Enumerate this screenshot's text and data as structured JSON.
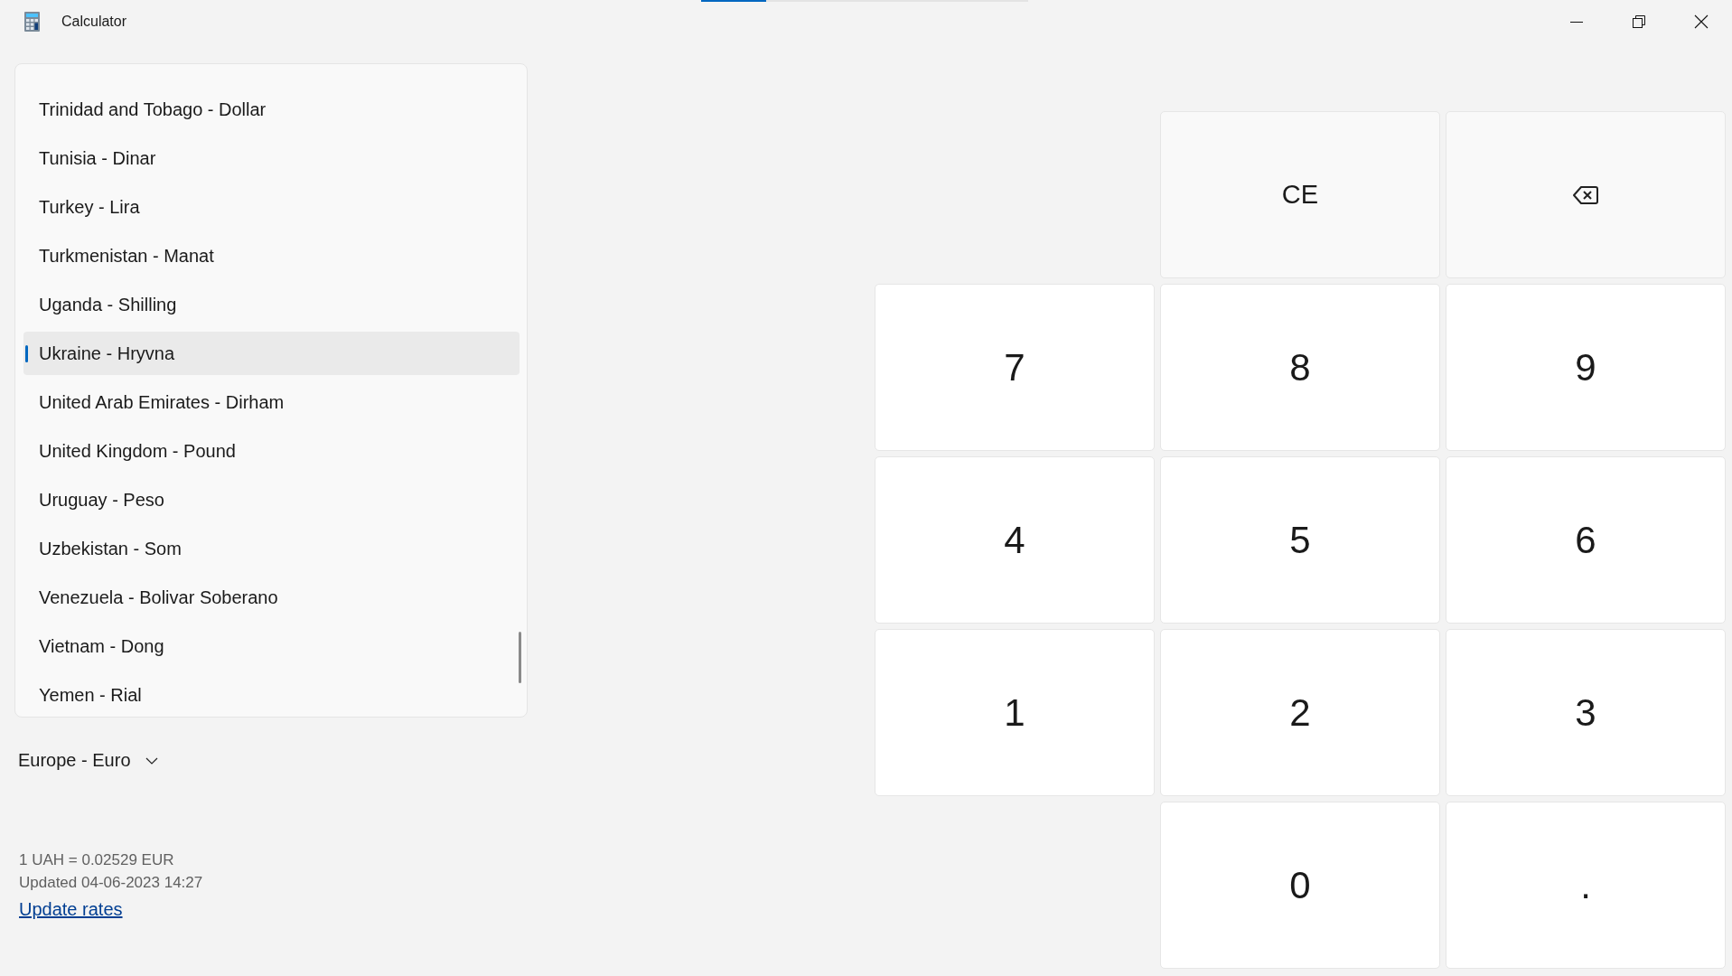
{
  "window": {
    "title": "Calculator"
  },
  "loading_bar": {
    "level": 0.2
  },
  "currency_list": {
    "items": [
      {
        "label": "Trinidad and Tobago - Dollar",
        "selected": false
      },
      {
        "label": "Tunisia - Dinar",
        "selected": false
      },
      {
        "label": "Turkey - Lira",
        "selected": false
      },
      {
        "label": "Turkmenistan - Manat",
        "selected": false
      },
      {
        "label": "Uganda - Shilling",
        "selected": false
      },
      {
        "label": "Ukraine - Hryvna",
        "selected": true
      },
      {
        "label": "United Arab Emirates - Dirham",
        "selected": false
      },
      {
        "label": "United Kingdom - Pound",
        "selected": false
      },
      {
        "label": "Uruguay - Peso",
        "selected": false
      },
      {
        "label": "Uzbekistan - Som",
        "selected": false
      },
      {
        "label": "Venezuela - Bolivar Soberano",
        "selected": false
      },
      {
        "label": "Vietnam - Dong",
        "selected": false
      },
      {
        "label": "Yemen - Rial",
        "selected": false
      }
    ]
  },
  "target_currency": {
    "label": "Europe - Euro"
  },
  "rate": "1 UAH = 0.02529 EUR",
  "updated": "Updated 04-06-2023 14:27",
  "update_link": "Update rates",
  "keypad": {
    "rows": [
      [
        {
          "kind": "empty"
        },
        {
          "kind": "function",
          "label": "CE"
        },
        {
          "kind": "backspace"
        }
      ],
      [
        {
          "kind": "digit",
          "label": "7"
        },
        {
          "kind": "digit",
          "label": "8"
        },
        {
          "kind": "digit",
          "label": "9"
        }
      ],
      [
        {
          "kind": "digit",
          "label": "4"
        },
        {
          "kind": "digit",
          "label": "5"
        },
        {
          "kind": "digit",
          "label": "6"
        }
      ],
      [
        {
          "kind": "digit",
          "label": "1"
        },
        {
          "kind": "digit",
          "label": "2"
        },
        {
          "kind": "digit",
          "label": "3"
        }
      ],
      [
        {
          "kind": "empty"
        },
        {
          "kind": "digit",
          "label": "0"
        },
        {
          "kind": "digit",
          "label": "."
        }
      ]
    ]
  }
}
